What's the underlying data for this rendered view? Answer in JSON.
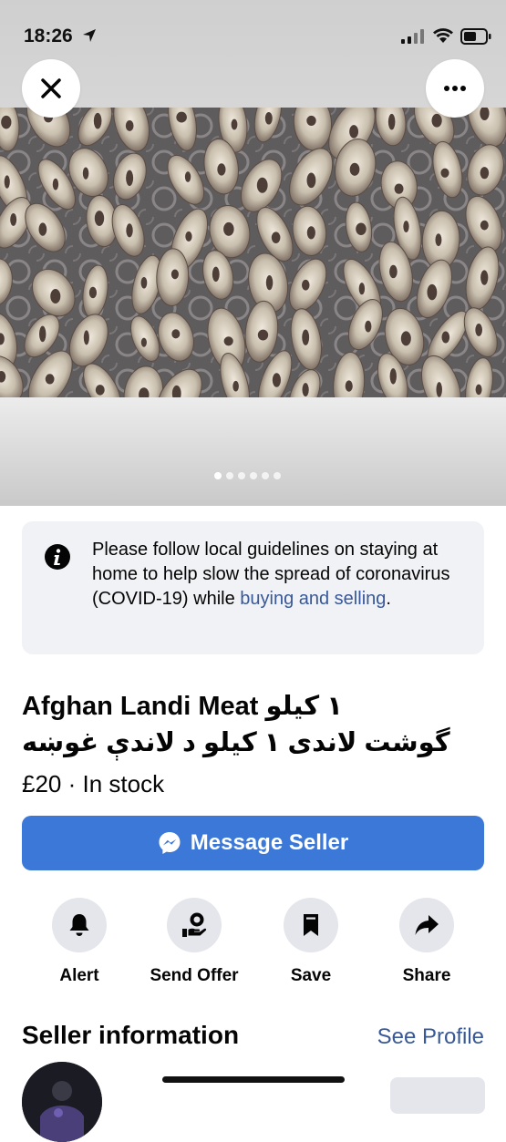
{
  "status_bar": {
    "time": "18:26"
  },
  "listing": {
    "image_count": 6,
    "active_image_index": 0,
    "notice": {
      "text": "Please follow local guidelines on staying at home to help slow the spread of coronavirus (COVID-19) while ",
      "link": "buying and selling",
      "end": "."
    },
    "title_line1": "Afghan Landi Meat ١ کیلو",
    "title_line2": "گوشت لاندی ١ کیلو د لاندې غوښه",
    "price": "£20 · In stock",
    "message_button": "Message Seller"
  },
  "actions": [
    {
      "label": "Alert",
      "icon": "bell-icon"
    },
    {
      "label": "Send Offer",
      "icon": "offer-icon"
    },
    {
      "label": "Save",
      "icon": "bookmark-icon"
    },
    {
      "label": "Share",
      "icon": "share-icon"
    }
  ],
  "seller": {
    "heading": "Seller information",
    "see_profile": "See Profile"
  },
  "colors": {
    "primary_button": "#3b78d8",
    "link": "#385898",
    "notice_bg": "#f0f2f5",
    "action_circle": "#e4e6eb"
  }
}
